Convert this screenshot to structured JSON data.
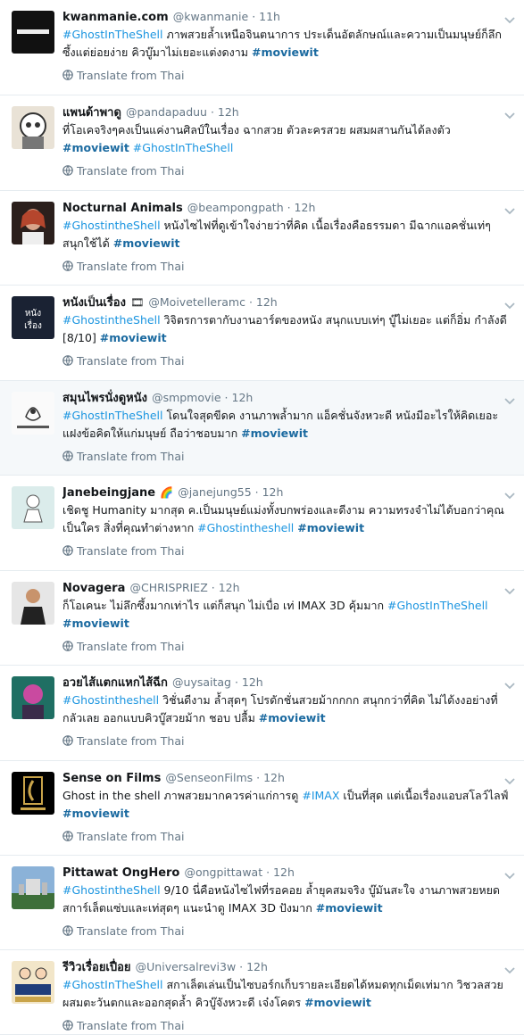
{
  "translate_label": "Translate from Thai",
  "tweets": [
    {
      "name": "kwanmanie.com",
      "handle": "@kwanmanie",
      "time": "11h",
      "emoji": "",
      "text": [
        {
          "t": "#GhostInTheShell",
          "k": "tag"
        },
        {
          "t": " ภาพสวยล้ำเหนือจินตนาการ ประเด็นอัตลักษณ์และความเป็นมนุษย์ก็ลึกซึ้งแต่ย่อยง่าย คิวบู๊มาไม่เยอะแต่งดงาม ",
          "k": ""
        },
        {
          "t": "#moviewit",
          "k": "tagb"
        }
      ]
    },
    {
      "name": "แพนด้าพาดู",
      "handle": "@pandapaduu",
      "time": "12h",
      "emoji": "",
      "text": [
        {
          "t": "ที่โอเคจริงๆคงเป็นแค่งานศิลป์ในเรื่อง ฉากสวย ตัวละครสวย ผสมผสานกันได้ลงตัว ",
          "k": ""
        },
        {
          "t": "#moviewit",
          "k": "tagb"
        },
        {
          "t": " ",
          "k": ""
        },
        {
          "t": "#GhostInTheShell",
          "k": "tag"
        }
      ]
    },
    {
      "name": "Nocturnal Animals",
      "handle": "@beampongpath",
      "time": "12h",
      "emoji": "",
      "text": [
        {
          "t": "#GhostintheShell",
          "k": "tag"
        },
        {
          "t": " หนังไซไฟที่ดูเข้าใจง่ายว่าที่คิด เนื้อเรื่องคือธรรมดา มีฉากแอคชั่นเท่ๆ สนุกใช้ได้ ",
          "k": ""
        },
        {
          "t": "#moviewit",
          "k": "tagb"
        }
      ]
    },
    {
      "name": "หนังเป็นเรื่อง",
      "handle": "@Moivetelleramc",
      "time": "12h",
      "emoji": "🎞",
      "text": [
        {
          "t": "#GhostintheShell",
          "k": "tag"
        },
        {
          "t": " วิจิตรการตากับงานอาร์ตของหนัง สนุกแบบเท่ๆ บู๊ไม่เยอะ แต่ก็อิ่ม กำลังดี [8/10] ",
          "k": ""
        },
        {
          "t": "#moviewit",
          "k": "tagb"
        }
      ]
    },
    {
      "name": "สมุนไพรนั่งดูหนัง",
      "handle": "@smpmovie",
      "time": "12h",
      "emoji": "",
      "text": [
        {
          "t": "#GhostInTheShell",
          "k": "tag"
        },
        {
          "t": " โดนใจสุดขีดค งานภาพล้ำมาก แอ็คชั่นจังหวะดี หนังมีอะไรให้คิดเยอะ แฝงข้อคิดให้แก่มนุษย์ ถือว่าชอบมาก ",
          "k": ""
        },
        {
          "t": "#moviewit",
          "k": "tagb"
        }
      ]
    },
    {
      "name": "Janebeingjane",
      "handle": "@janejung55",
      "time": "12h",
      "emoji": "🌈",
      "text": [
        {
          "t": "เชิดชู Humanity มากสุด ค.เป็นมนุษย์แม่งทั้งบกพร่องและดีงาม ความทรงจำไม่ได้บอกว่าคุณเป็นใคร สิ่งที่คุณทำต่างหาก  ",
          "k": ""
        },
        {
          "t": "#Ghostintheshell",
          "k": "tag"
        },
        {
          "t": " ",
          "k": ""
        },
        {
          "t": "#moviewit",
          "k": "tagb"
        }
      ]
    },
    {
      "name": "Novagera",
      "handle": "@CHRISPRIEZ",
      "time": "12h",
      "emoji": "",
      "text": [
        {
          "t": "ก็โอเคนะ ไม่ลึกซึ้งมากเท่าไร แต่ก็สนุก ไม่เบื่อ เท่ IMAX 3D คุ้มมาก ",
          "k": ""
        },
        {
          "t": "#GhostInTheShell",
          "k": "tag"
        },
        {
          "t": " ",
          "k": ""
        },
        {
          "t": "#moviewit",
          "k": "tagb"
        }
      ]
    },
    {
      "name": "อวยไส้แตกแหกไส้ฉีก",
      "handle": "@uysaitag",
      "time": "12h",
      "emoji": "",
      "text": [
        {
          "t": "#Ghostintheshell",
          "k": "tag"
        },
        {
          "t": " วิชั่นดีงาม ล้ำสุดๆ โปรดักชั่นสวยม้ากกกก สนุกกว่าที่คิด ไม่ได้งงอย่างที่กลัวเลย ออกแบบคิวบู๊สวยม้าก ชอบ ปลื้ม  ",
          "k": ""
        },
        {
          "t": "#moviewit",
          "k": "tagb"
        }
      ]
    },
    {
      "name": "Sense on Films",
      "handle": "@SenseonFilms",
      "time": "12h",
      "emoji": "",
      "text": [
        {
          "t": "Ghost in the shell ภาพสวยมากควรค่าแก่การดู ",
          "k": ""
        },
        {
          "t": "#IMAX",
          "k": "tag"
        },
        {
          "t": " เป็นที่สุด แต่เนื้อเรื่องแอบสโลว์ไลฟ์ ",
          "k": ""
        },
        {
          "t": "#moviewit",
          "k": "tagb"
        }
      ]
    },
    {
      "name": "Pittawat OngHero",
      "handle": "@ongpittawat",
      "time": "12h",
      "emoji": "",
      "text": [
        {
          "t": "#GhostintheShell",
          "k": "tag"
        },
        {
          "t": " 9/10 นี่คือหนังไซไฟที่รอคอย ล้ำยุคสมจริง บู๊มันสะใจ งานภาพสวยหยด สการ์เล็ตแซ่บและเท่สุดๆ แนะนำดู IMAX 3D ปังมาก ",
          "k": ""
        },
        {
          "t": "#moviewit",
          "k": "tagb"
        }
      ]
    },
    {
      "name": "รีวิวเรื่อยเปื่อย",
      "handle": "@Universalrevi3w",
      "time": "12h",
      "emoji": "",
      "text": [
        {
          "t": "#GhostInTheShell",
          "k": "tag"
        },
        {
          "t": " สกาเล็ตเล่นเป็นไซบอร์กเก็บรายละเอียดได้หมดทุกเม็ดเท่มาก วิชวลสวยผสมตะวันตกและออกสุดล้ำ คิวบู๊จังหวะดี เจ๋งโคตร ",
          "k": ""
        },
        {
          "t": "#moviewit",
          "k": "tagb"
        }
      ]
    }
  ]
}
